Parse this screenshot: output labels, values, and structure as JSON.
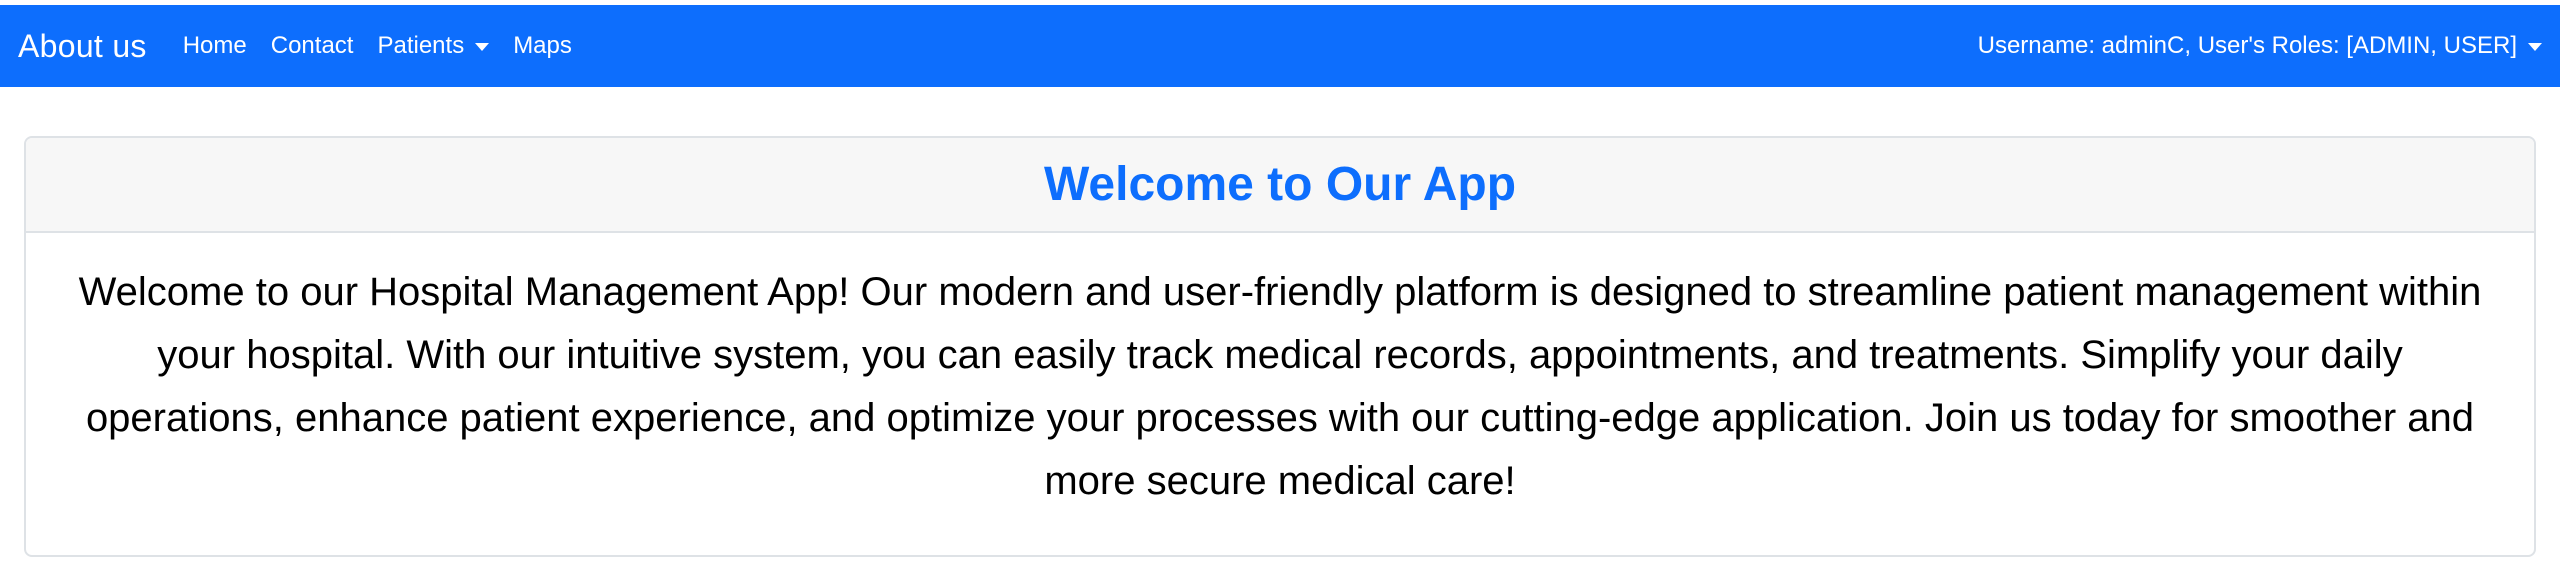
{
  "navbar": {
    "brand": "About us",
    "links": [
      {
        "label": "Home"
      },
      {
        "label": "Contact"
      },
      {
        "label": "Patients"
      },
      {
        "label": "Maps"
      }
    ],
    "user_menu_label": "Username: adminC, User's Roles: [ADMIN, USER]",
    "background_color": "#0d6efd"
  },
  "card": {
    "title": "Welcome to Our App",
    "body": "Welcome to our Hospital Management App! Our modern and user-friendly platform is designed to streamline patient management within your hospital. With our intuitive system, you can easily track medical records, appointments, and treatments. Simplify your daily operations, enhance patient experience, and optimize your processes with our cutting-edge application. Join us today for smoother and more secure medical care!",
    "title_color": "#0d6efd"
  }
}
